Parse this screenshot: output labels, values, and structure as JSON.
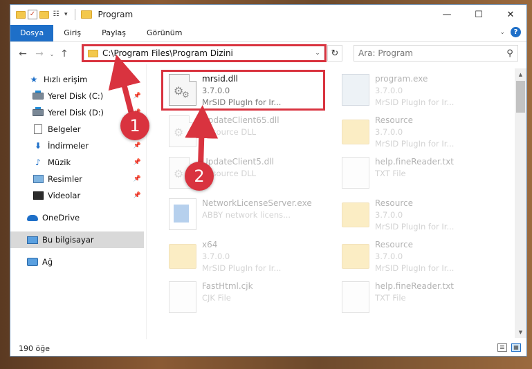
{
  "window": {
    "title": "Program",
    "controls": {
      "minimize": "—",
      "maximize": "☐",
      "close": "✕"
    }
  },
  "ribbon": {
    "tabs": [
      "Dosya",
      "Giriş",
      "Paylaş",
      "Görünüm"
    ]
  },
  "navigation": {
    "address": "C:\\Program Files\\Program Dizini",
    "search_placeholder": "Ara: Program"
  },
  "sidebar": {
    "items": [
      {
        "label": "Hızlı erişim",
        "icon": "star-icon",
        "pinned": false
      },
      {
        "label": "Yerel Disk (C:)",
        "icon": "disk-icon",
        "pinned": true
      },
      {
        "label": "Yerel Disk (D:)",
        "icon": "disk-icon",
        "pinned": true
      },
      {
        "label": "Belgeler",
        "icon": "document-icon",
        "pinned": true
      },
      {
        "label": "İndirmeler",
        "icon": "download-icon",
        "pinned": true
      },
      {
        "label": "Müzik",
        "icon": "music-icon",
        "pinned": true
      },
      {
        "label": "Resimler",
        "icon": "pictures-icon",
        "pinned": true
      },
      {
        "label": "Videolar",
        "icon": "videos-icon",
        "pinned": true
      },
      {
        "label": "OneDrive",
        "icon": "cloud-icon",
        "pinned": false
      },
      {
        "label": "Bu bilgisayar",
        "icon": "computer-icon",
        "pinned": false,
        "selected": true
      },
      {
        "label": "Ağ",
        "icon": "network-icon",
        "pinned": false
      }
    ]
  },
  "files": [
    {
      "name": "mrsid.dll",
      "line2": "3.7.0.0",
      "line3": "MrSID PlugIn for Ir...",
      "type": "dll",
      "highlighted": true
    },
    {
      "name": "program.exe",
      "line2": "3.7.0.0",
      "line3": "MrSID PlugIn for Ir...",
      "type": "exe"
    },
    {
      "name": "UpdateClient65.dll",
      "line2": "Resource DLL",
      "type": "dll"
    },
    {
      "name": "Resource",
      "line2": "3.7.0.0",
      "line3": "MrSID PlugIn for Ir...",
      "type": "folder"
    },
    {
      "name": "UpdateClient5.dll",
      "line2": "Resource DLL",
      "type": "dll"
    },
    {
      "name": "help.fineReader.txt",
      "line2": "TXT File",
      "type": "txt"
    },
    {
      "name": "NetworkLicenseServer.exe",
      "line2": "ABBY network licens...",
      "type": "app"
    },
    {
      "name": "Resource",
      "line2": "3.7.0.0",
      "line3": "MrSID PlugIn for Ir...",
      "type": "folder"
    },
    {
      "name": "x64",
      "line2": "3.7.0.0",
      "line3": "MrSID PlugIn for Ir...",
      "type": "folder"
    },
    {
      "name": "Resource",
      "line2": "3.7.0.0",
      "line3": "MrSID PlugIn for Ir...",
      "type": "folder"
    },
    {
      "name": "FastHtml.cjk",
      "line2": "CJK File",
      "type": "txt"
    },
    {
      "name": "help.fineReader.txt",
      "line2": "TXT File",
      "type": "txt"
    }
  ],
  "status": {
    "item_count": "190 öğe"
  },
  "annotations": {
    "step1": "1",
    "step2": "2"
  },
  "colors": {
    "accent": "#1e6fc8",
    "annotation": "#d9333f",
    "folder": "#f3c84c"
  }
}
